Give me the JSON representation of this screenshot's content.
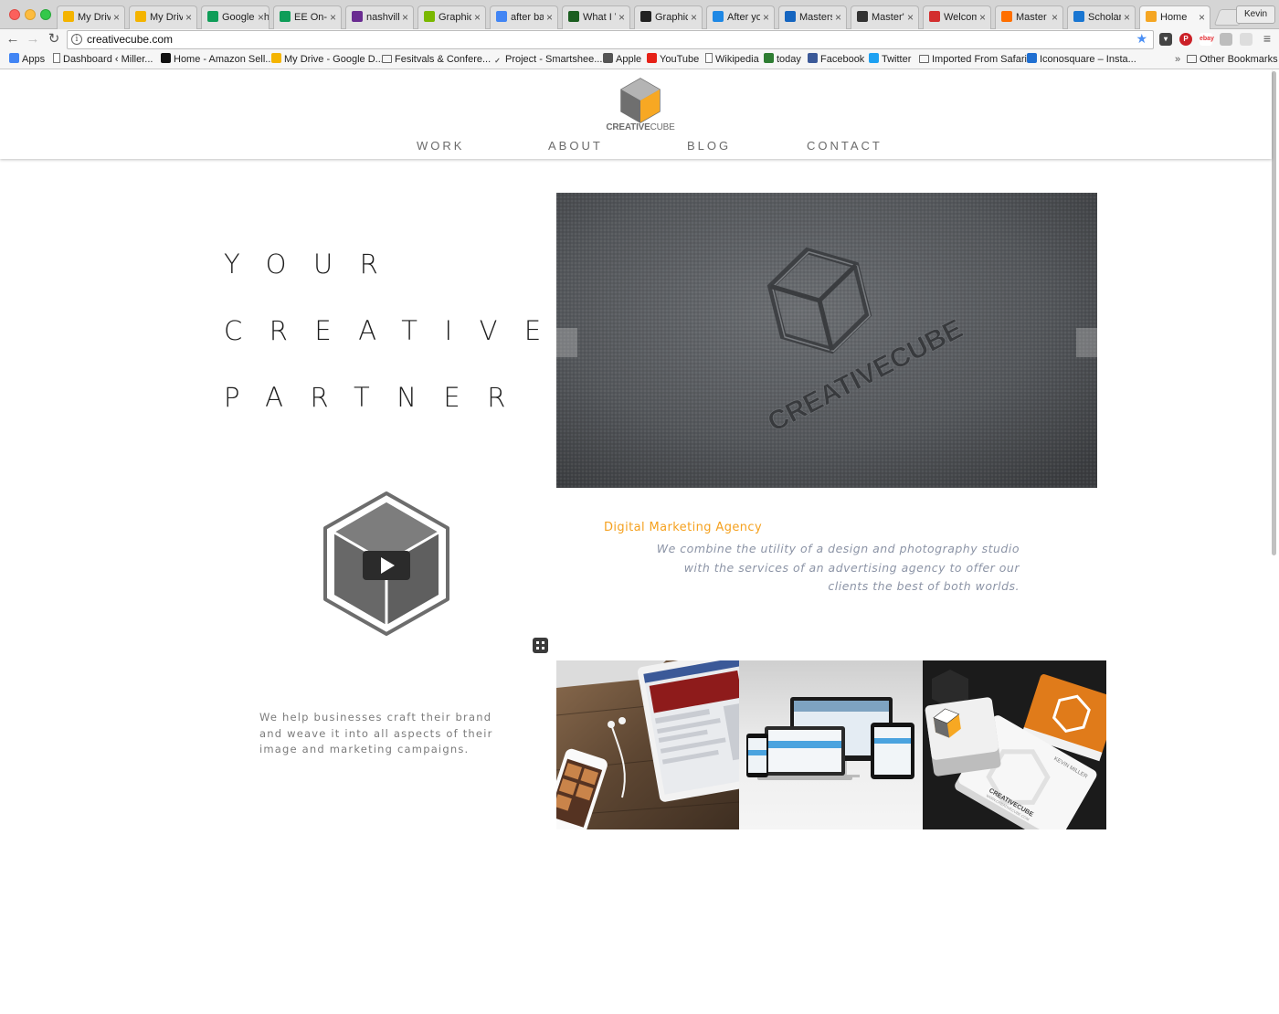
{
  "browser": {
    "tabs": [
      {
        "label": "My Drive",
        "icon": "google-drive-icon",
        "color": "#f4b400"
      },
      {
        "label": "My Drive",
        "icon": "google-drive-icon",
        "color": "#f4b400"
      },
      {
        "label": "Google Sheets",
        "icon": "google-sheets-icon",
        "color": "#0f9d58"
      },
      {
        "label": "EE On-S",
        "icon": "google-sheets-icon",
        "color": "#0f9d58"
      },
      {
        "label": "nashville",
        "icon": "peace-icon",
        "color": "#6a2c91"
      },
      {
        "label": "Graphic",
        "icon": "graphic-icon",
        "color": "#7ab800"
      },
      {
        "label": "after ba",
        "icon": "google-icon",
        "color": "#4285f4"
      },
      {
        "label": "What I V",
        "icon": "shield-icon",
        "color": "#1b5e20"
      },
      {
        "label": "Graphic",
        "icon": "graphic-dark-icon",
        "color": "#222222"
      },
      {
        "label": "After yo",
        "icon": "k-icon",
        "color": "#1e88e5"
      },
      {
        "label": "Masters",
        "icon": "play-icon",
        "color": "#1565c0"
      },
      {
        "label": "Master's",
        "icon": "github-icon",
        "color": "#333333"
      },
      {
        "label": "Welcom",
        "icon": "a-icon",
        "color": "#d32f2f"
      },
      {
        "label": "Master o",
        "icon": "orange-icon",
        "color": "#ff6f00"
      },
      {
        "label": "Scholars",
        "icon": "fw-icon",
        "color": "#1976d2"
      },
      {
        "label": "Home",
        "icon": "cube-icon",
        "color": "#f5a623",
        "active": true
      }
    ],
    "profile": "Kevin",
    "url": "creativecube.com",
    "bookmarks": [
      {
        "label": "Apps",
        "icon": "apps-icon"
      },
      {
        "label": "Dashboard ‹ Miller...",
        "icon": "page-icon"
      },
      {
        "label": "Home - Amazon Sell...",
        "icon": "amazon-icon"
      },
      {
        "label": "My Drive - Google D...",
        "icon": "google-drive-icon"
      },
      {
        "label": "Fesitvals & Confere...",
        "icon": "folder-icon"
      },
      {
        "label": "Project - Smartshee...",
        "icon": "checkmark-icon"
      },
      {
        "label": "Apple",
        "icon": "apple-icon"
      },
      {
        "label": "YouTube",
        "icon": "youtube-icon"
      },
      {
        "label": "Wikipedia",
        "icon": "page-icon"
      },
      {
        "label": "today",
        "icon": "today-icon"
      },
      {
        "label": "Facebook",
        "icon": "facebook-icon"
      },
      {
        "label": "Twitter",
        "icon": "twitter-icon"
      },
      {
        "label": "Imported From Safari",
        "icon": "folder-icon"
      },
      {
        "label": "Iconosquare – Insta...",
        "icon": "iconosquare-icon"
      }
    ],
    "other_bookmarks": "Other Bookmarks",
    "overflow": "»"
  },
  "site": {
    "logo": {
      "bold": "CREATIVE",
      "light": "CUBE"
    },
    "nav": [
      "WORK",
      "ABOUT",
      "BLOG",
      "CONTACT"
    ],
    "hero": [
      "YOUR",
      "CREATIVE",
      "PARTNER"
    ],
    "slider_brand": "CREATIVECUBE",
    "agency_title": "Digital Marketing Agency",
    "agency_desc": "We combine the utility of a design and photography studio with the services of an advertising agency to offer our clients the best of both worlds.",
    "tagline": "We help businesses craft their brand and weave it into all aspects of their image and marketing campaigns.",
    "card_name": "KEVIN MILLER",
    "card_brand": "CREATIVECUBE",
    "card_site": "WWW.CREATIVECUBE.COM",
    "colors": {
      "accent": "#f5a11f",
      "muted": "#8c94a6",
      "nav": "#6b6b6b"
    }
  }
}
